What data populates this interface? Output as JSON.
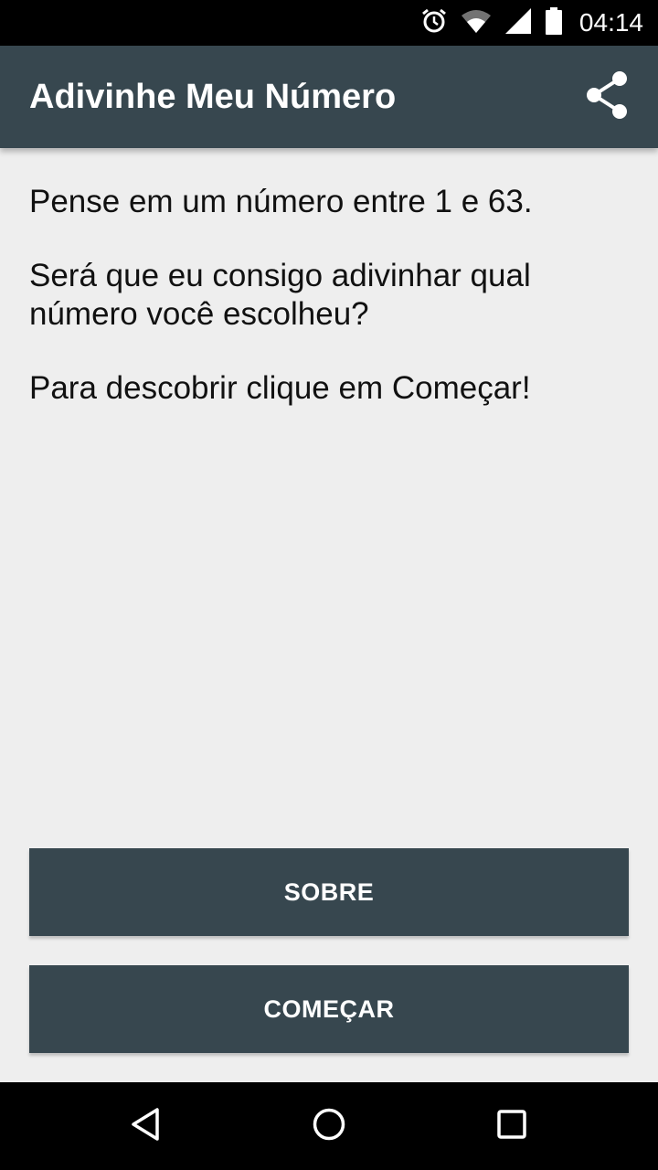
{
  "status_bar": {
    "time": "04:14",
    "icons": [
      "alarm-icon",
      "wifi-icon",
      "signal-icon",
      "battery-icon"
    ]
  },
  "app_bar": {
    "title": "Adivinhe Meu Número",
    "action_icon": "share-icon",
    "color": "#37474f"
  },
  "main": {
    "paragraphs": [
      "Pense em um número entre 1 e 63.",
      "Será que eu consigo adivinhar qual número você escolheu?",
      "Para descobrir clique em Começar!"
    ]
  },
  "buttons": {
    "sobre": "SOBRE",
    "comecar": "COMEÇAR"
  },
  "nav_bar": {
    "icons": [
      "back-icon",
      "home-icon",
      "recents-icon"
    ]
  }
}
